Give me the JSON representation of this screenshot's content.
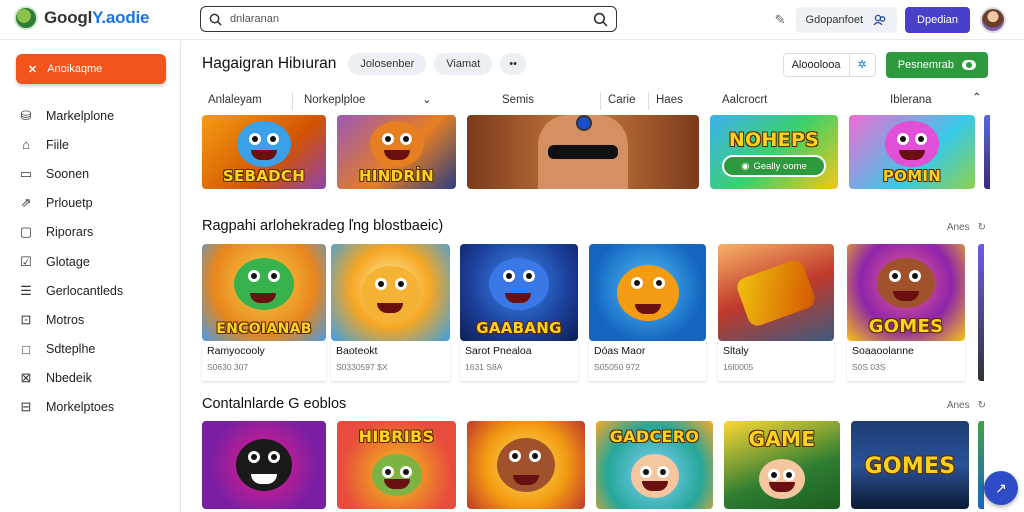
{
  "header": {
    "logo": {
      "text_main": "Googl",
      "text_accent": "Y.aodie"
    },
    "search": {
      "value": "dnlaranan",
      "placeholder": ""
    },
    "pin_icon": "pin-icon",
    "selector": {
      "label": "Gdopanfoet"
    },
    "primary_button": "Dpedian"
  },
  "sidebar": {
    "cta": "Anoikaqme",
    "items": [
      {
        "label": "Markelplone",
        "icon": "store-icon"
      },
      {
        "label": "Fiile",
        "icon": "home-icon"
      },
      {
        "label": "Soonen",
        "icon": "screen-icon"
      },
      {
        "label": "Prlouetp",
        "icon": "export-icon"
      },
      {
        "label": "Riporars",
        "icon": "folder-icon"
      },
      {
        "label": "Glotage",
        "icon": "check-icon"
      },
      {
        "label": "Gerlocantleds",
        "icon": "list-icon"
      },
      {
        "label": "Motros",
        "icon": "lock-icon"
      },
      {
        "label": "Sdteplhe",
        "icon": "square-icon"
      },
      {
        "label": "Nbedeik",
        "icon": "chart-icon"
      },
      {
        "label": "Morkelptoes",
        "icon": "bag-icon"
      }
    ]
  },
  "main": {
    "page_title": "Hagaigran Hibıuran",
    "chips": [
      "Jolosenber",
      "Viamat",
      "••"
    ],
    "segment": {
      "label": "Alooolooa"
    },
    "green_button": "Pesnemrab",
    "filters": [
      "Anlaleyam",
      "Norkeplploe",
      "Semis",
      "Carie",
      "Haes",
      "Aalcrocrt",
      "Iblerana"
    ],
    "top_row": [
      {
        "title": "SEBADCH"
      },
      {
        "title": "HINDRİN"
      },
      {
        "title": ""
      },
      {
        "title": "NOHEPS",
        "pill": "Geally oome"
      },
      {
        "title": "POMIN"
      }
    ],
    "section1": {
      "title": "Ragpahi arlohekradeg ľng blostbaeic)",
      "more": "Anes",
      "cards": [
        {
          "title": "ENCOIANAB",
          "name": "Ramyocooly",
          "sub": "S0630 307"
        },
        {
          "title": "",
          "name": "Baoteokt",
          "sub": "S0330597 $X"
        },
        {
          "title": "GAABANG",
          "name": "Sarot Pnealoa",
          "sub": "1631 S8A"
        },
        {
          "title": "",
          "name": "Dóas Maor",
          "sub": "S05050 972"
        },
        {
          "title": "",
          "name": "Sltaly",
          "sub": "16l0005"
        },
        {
          "title": "GOMES",
          "name": "Soaaoolanne",
          "sub": "S0S 03S"
        }
      ]
    },
    "section2": {
      "title": "Contalnlarde G eoblos",
      "more": "Anes",
      "tiles": [
        {
          "title": ""
        },
        {
          "title": "HIBRIBS"
        },
        {
          "title": ""
        },
        {
          "title": "GADCERO"
        },
        {
          "title": "GAME"
        },
        {
          "title": "GOMES"
        }
      ]
    }
  },
  "colors": {
    "accent_orange": "#f2541b",
    "accent_blue": "#4a3fc8",
    "accent_green": "#2e9a3e",
    "fab_blue": "#2f4cc7"
  }
}
